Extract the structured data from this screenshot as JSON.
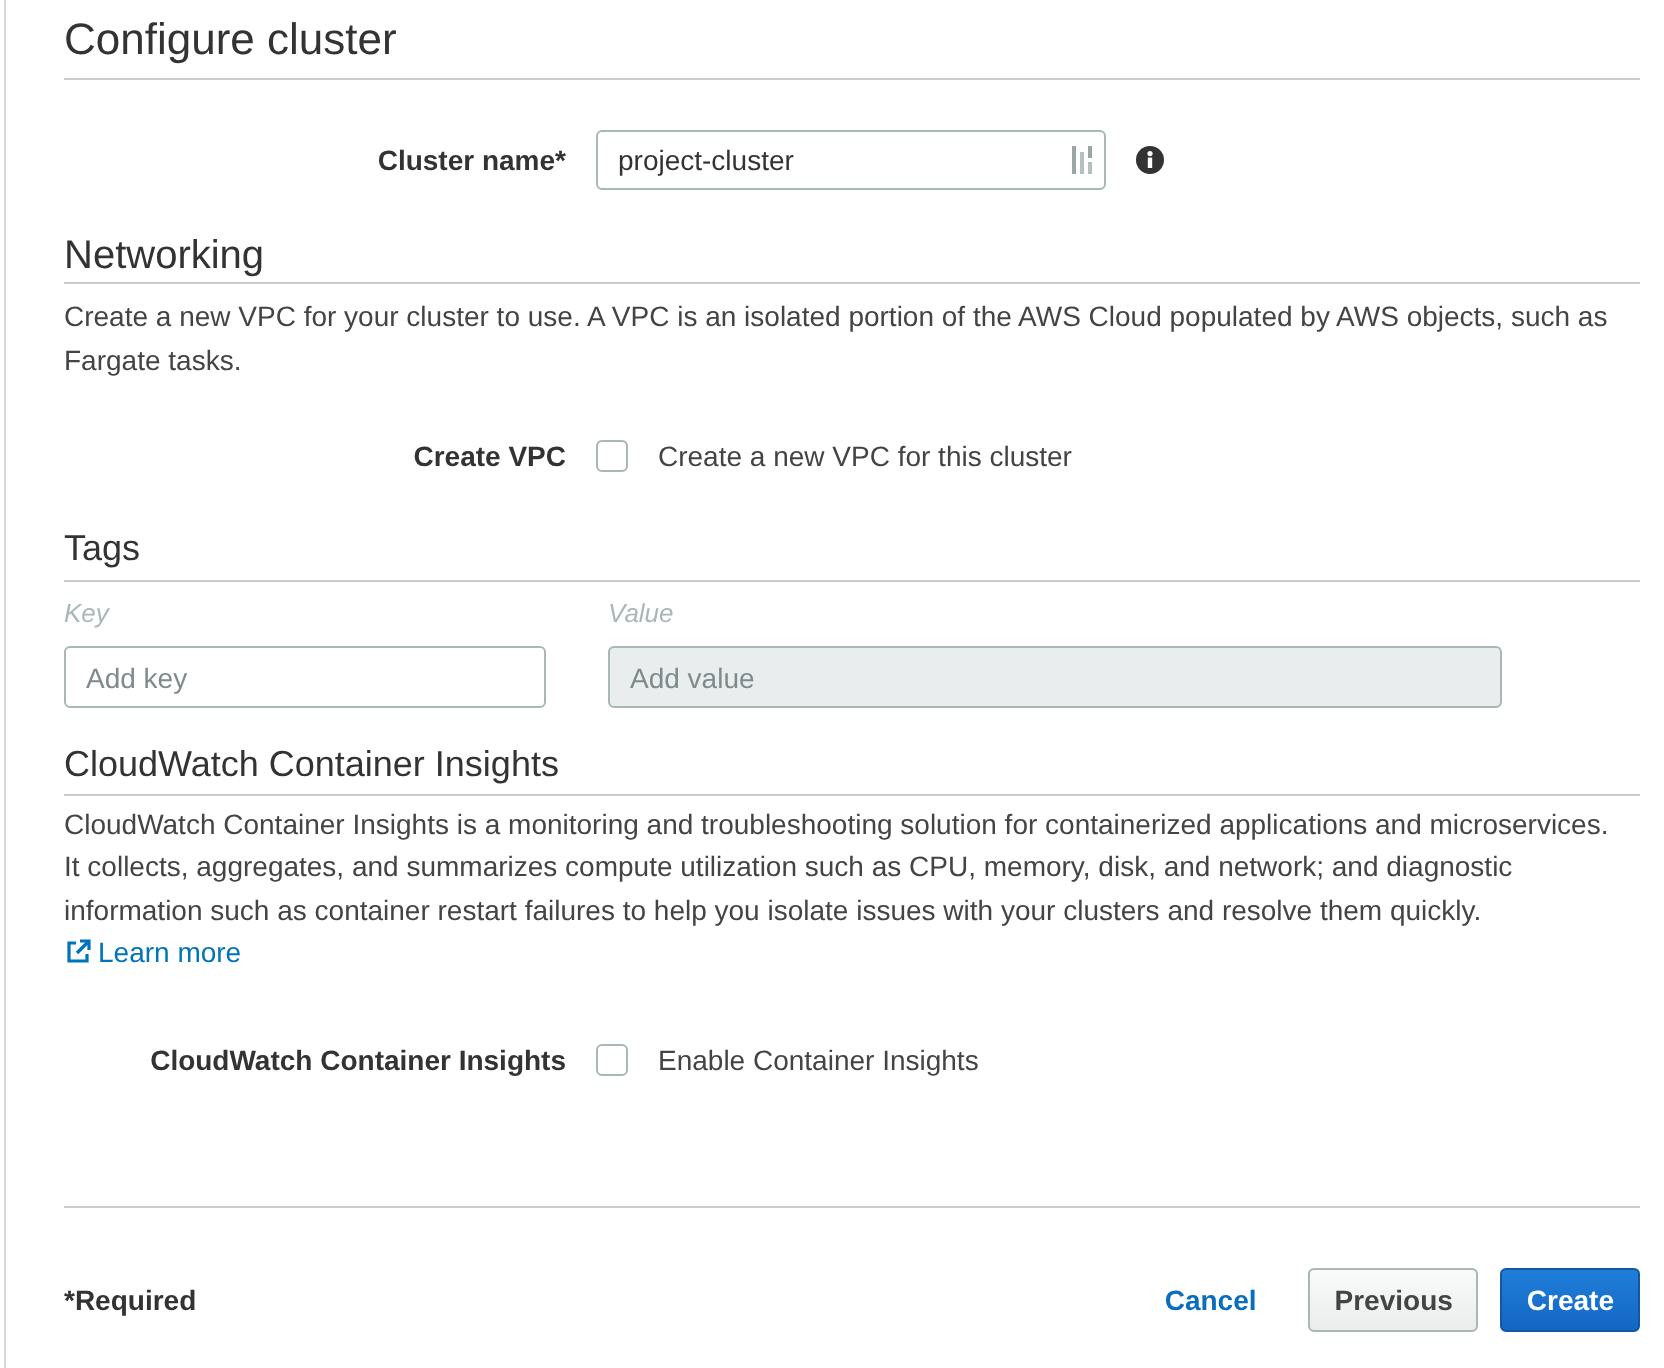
{
  "page": {
    "title": "Configure cluster"
  },
  "cluster_name": {
    "label": "Cluster name*",
    "value": "project-cluster"
  },
  "networking": {
    "heading": "Networking",
    "description": "Create a new VPC for your cluster to use. A VPC is an isolated portion of the AWS Cloud populated by AWS objects, such as Fargate tasks.",
    "create_vpc": {
      "label": "Create VPC",
      "option": "Create a new VPC for this cluster",
      "checked": false
    }
  },
  "tags": {
    "heading": "Tags",
    "key_label": "Key",
    "value_label": "Value",
    "key_field": {
      "placeholder": "Add key",
      "disabled": false
    },
    "value_field": {
      "placeholder": "Add value",
      "disabled": true
    }
  },
  "container_insights": {
    "heading": "CloudWatch Container Insights",
    "description": "CloudWatch Container Insights is a monitoring and troubleshooting solution for containerized applications and microservices. It collects, aggregates, and summarizes compute utilization such as CPU, memory, disk, and network; and diagnostic information such as container restart failures to help you isolate issues with your clusters and resolve them quickly.",
    "link": "Learn more",
    "setting": {
      "label": "CloudWatch Container Insights",
      "option": "Enable Container Insights",
      "checked": false
    }
  },
  "footer": {
    "required_note": "*Required",
    "buttons": [
      {
        "label": "Cancel",
        "kind": "link"
      },
      {
        "label": "Previous",
        "kind": "secondary"
      },
      {
        "label": "Create",
        "kind": "primary"
      }
    ]
  }
}
